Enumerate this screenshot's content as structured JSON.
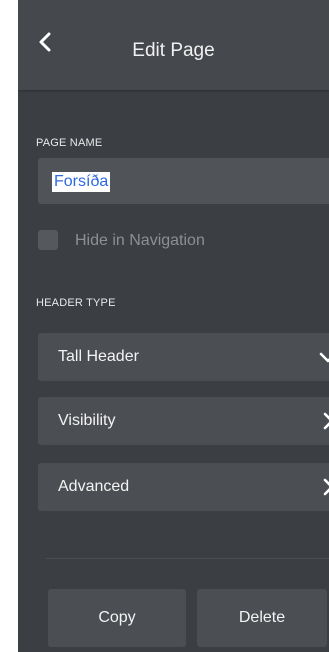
{
  "header": {
    "title": "Edit Page",
    "back_icon": "chevron-left-icon"
  },
  "page_name": {
    "label": "PAGE NAME",
    "value": "Forsíða"
  },
  "hide_in_navigation": {
    "label": "Hide in Navigation",
    "checked": false
  },
  "header_type": {
    "label": "HEADER TYPE",
    "selected": "Tall Header",
    "icon": "chevron-down-icon"
  },
  "rows": [
    {
      "label": "Visibility",
      "icon": "chevron-right-icon"
    },
    {
      "label": "Advanced",
      "icon": "chevron-right-icon"
    }
  ],
  "actions": {
    "copy_label": "Copy",
    "delete_label": "Delete"
  },
  "colors": {
    "panel_bg": "#3b3e42",
    "header_bg": "#45484d",
    "control_bg": "#4b4e53",
    "selection_text": "#2d6ae0"
  }
}
